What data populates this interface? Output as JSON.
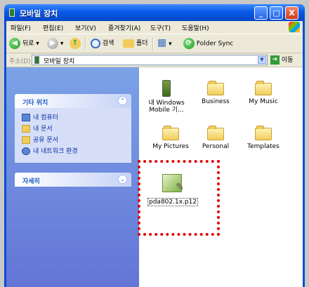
{
  "window": {
    "title": "모바일 장치"
  },
  "title_buttons": {
    "minimize": "_",
    "maximize": "□",
    "close": "X"
  },
  "menu": [
    "파일(F)",
    "편집(E)",
    "보기(V)",
    "즐겨찾기(A)",
    "도구(T)",
    "도움말(H)"
  ],
  "toolbar": {
    "back": "뒤로",
    "back_arrow": "◀",
    "forward_arrow": "▶",
    "up_arrow": "↑",
    "search": "검색",
    "folders": "폴더",
    "view_glyph": "▦",
    "folder_sync": "Folder Sync"
  },
  "address": {
    "label": "주소(D)",
    "value": "모바일 장치",
    "go": "이동",
    "go_arrow": "➔",
    "drop": "▼"
  },
  "task_panes": {
    "other_places": {
      "title": "기타 위치",
      "chevron": "⌃",
      "links": [
        "내 컴퓨터",
        "내 문서",
        "공유 문서",
        "내 네트워크 환경"
      ]
    },
    "details": {
      "title": "자세히",
      "chevron": "⌄"
    }
  },
  "files": [
    {
      "name": "내 Windows Mobile 기...",
      "line1": "내 Windows",
      "line2": "Mobile 기...",
      "icon": "device-icon"
    },
    {
      "name": "Business",
      "icon": "folder-icon"
    },
    {
      "name": "My Music",
      "icon": "folder-icon"
    },
    {
      "name": "My Pictures",
      "icon": "folder-icon"
    },
    {
      "name": "Personal",
      "icon": "folder-icon"
    },
    {
      "name": "Templates",
      "icon": "folder-icon"
    },
    {
      "name": "pda802.1x.p12",
      "icon": "certificate-icon"
    }
  ],
  "colors": {
    "title_bar": "#0a5ae8",
    "task_pane": "#6375d6",
    "highlight": "#e30000"
  }
}
